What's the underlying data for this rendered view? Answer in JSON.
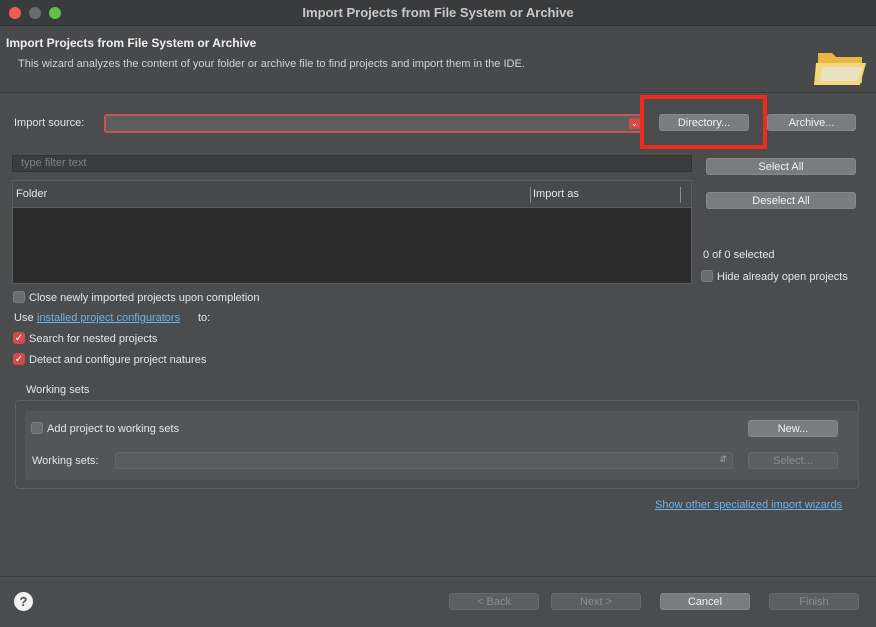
{
  "window": {
    "title": "Import Projects from File System or Archive"
  },
  "header": {
    "title": "Import Projects from File System or Archive",
    "description": "This wizard analyzes the content of your folder or archive file to find projects and import them in the IDE.",
    "icon": "folder-open-icon"
  },
  "source": {
    "label": "Import source:",
    "value": "",
    "directory_button": "Directory...",
    "archive_button": "Archive..."
  },
  "filter": {
    "placeholder": "type filter text"
  },
  "table": {
    "columns": [
      "Folder",
      "Import as"
    ],
    "rows": []
  },
  "side": {
    "select_all": "Select All",
    "deselect_all": "Deselect All",
    "selected_count": "0 of 0 selected",
    "hide_open_label": "Hide already open projects"
  },
  "options": {
    "close_imported_label": "Close newly imported projects upon completion",
    "use_prefix": "Use",
    "configurators_link": "installed project configurators",
    "use_suffix": "to:",
    "search_nested_label": "Search for nested projects",
    "detect_natures_label": "Detect and configure project natures"
  },
  "working_sets": {
    "group_label": "Working sets",
    "add_label": "Add project to working sets",
    "new_button": "New...",
    "sets_label": "Working sets:",
    "select_button": "Select..."
  },
  "show_other_link": "Show other specialized import wizards",
  "footer": {
    "back": "< Back",
    "next": "Next >",
    "cancel": "Cancel",
    "finish": "Finish",
    "help": "?"
  },
  "colors": {
    "accent": "#d24b4b",
    "highlight": "#ee2b1e",
    "link": "#6cb4ec"
  }
}
